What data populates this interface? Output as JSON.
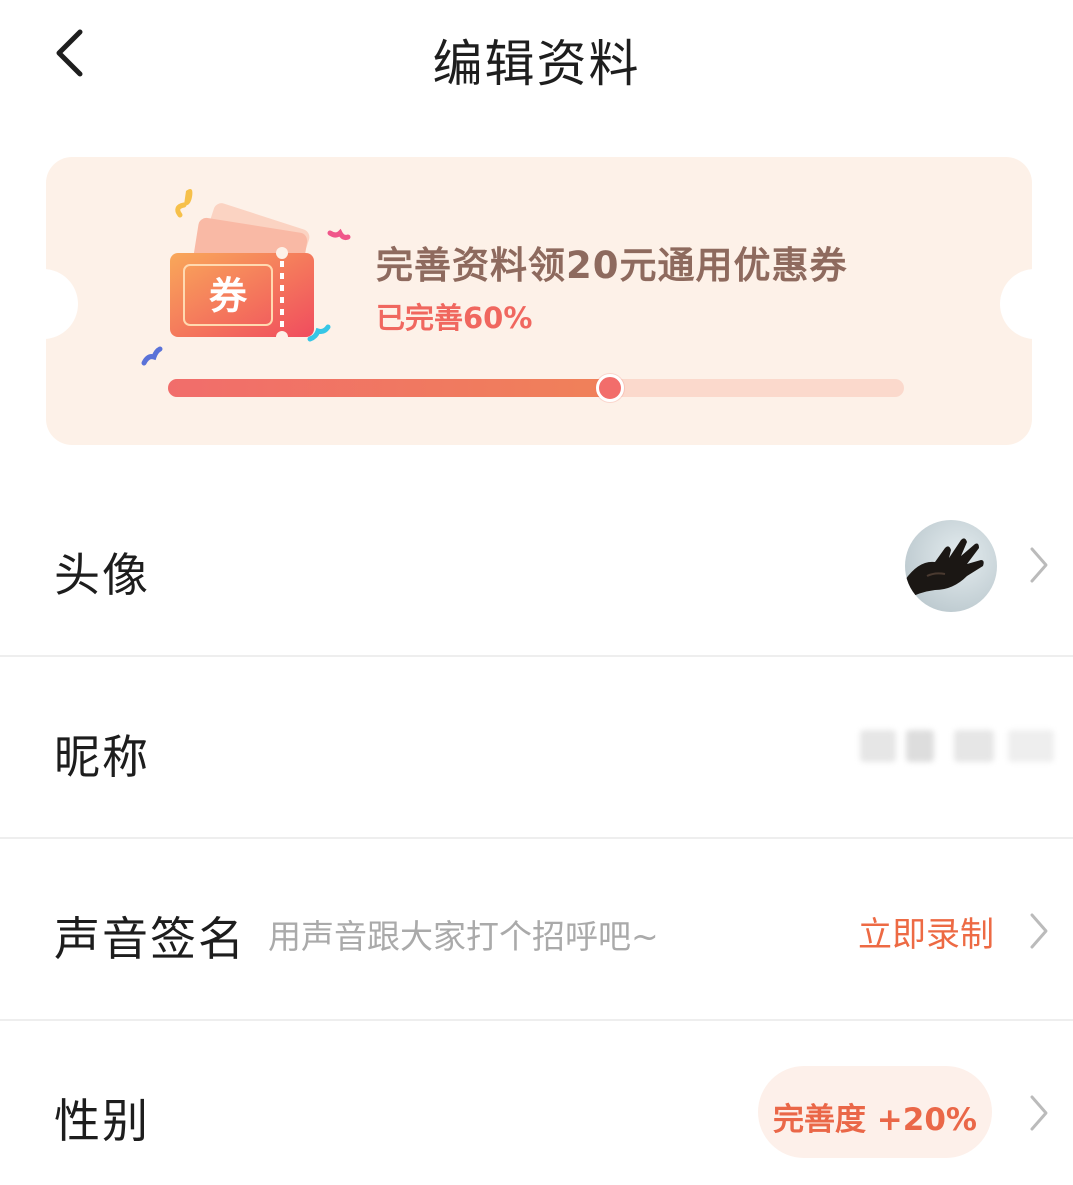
{
  "header": {
    "title": "编辑资料"
  },
  "banner": {
    "ticket_char": "券",
    "title": "完善资料领20元通用优惠券",
    "progress_text": "已完善60%",
    "progress": 0.6
  },
  "rows": {
    "avatar": {
      "label": "头像"
    },
    "nickname": {
      "label": "昵称"
    },
    "voice": {
      "label": "声音签名",
      "hint": "用声音跟大家打个招呼吧~",
      "action": "立即录制"
    },
    "gender": {
      "label": "性别",
      "badge": "完善度 +20%"
    }
  },
  "colors": {
    "accent": "#f0675f",
    "banner_bg": "#fdf1e8",
    "link": "#ed6a44"
  },
  "icons": {
    "back": "back-arrow-icon",
    "chevron": "chevron-right-icon",
    "ticket": "coupon-ticket-icon"
  }
}
